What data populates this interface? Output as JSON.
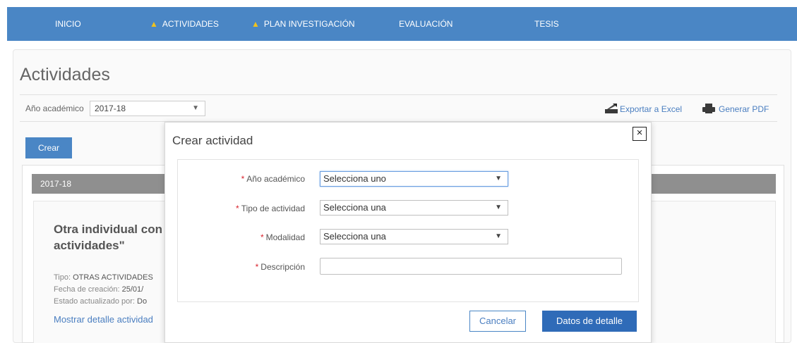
{
  "nav": {
    "items": [
      {
        "label": "INICIO",
        "warning": false
      },
      {
        "label": "ACTIVIDADES",
        "warning": true
      },
      {
        "label": "PLAN INVESTIGACIÓN",
        "warning": true
      },
      {
        "label": "EVALUACIÓN",
        "warning": false
      },
      {
        "label": "TESIS",
        "warning": false
      }
    ]
  },
  "page": {
    "title": "Actividades",
    "year_label": "Año académico",
    "year_value": "2017-18",
    "export_excel": "Exportar a Excel",
    "export_pdf": "Generar PDF",
    "create_button": "Crear"
  },
  "section": {
    "header": "2017-18",
    "card": {
      "title": "Otra individual con \"",
      "title_line2": "actividades\"",
      "tipo_label": "Tipo:",
      "tipo_value": "OTRAS ACTIVIDADES",
      "fecha_label": "Fecha de creación:",
      "fecha_value": "25/01/",
      "estado_label": "Estado actualizado por:",
      "estado_value": "Do",
      "detail_link": "Mostrar detalle actividad"
    }
  },
  "modal": {
    "title": "Crear actividad",
    "close_label": "×",
    "fields": {
      "year": {
        "label": "Año académico",
        "value": "Selecciona uno"
      },
      "tipo": {
        "label": "Tipo de actividad",
        "value": "Selecciona una"
      },
      "modalidad": {
        "label": "Modalidad",
        "value": "Selecciona una"
      },
      "descripcion": {
        "label": "Descripción",
        "value": ""
      }
    },
    "required_mark": "*",
    "cancel_button": "Cancelar",
    "detail_button": "Datos de detalle"
  },
  "colors": {
    "nav_bg": "#4a86c5",
    "warning": "#f0c21c",
    "primary_button": "#2f6bb8",
    "link": "#4a7ec0",
    "required": "#d9232d",
    "section_header": "#8f8f8f"
  },
  "icons": {
    "warning": "warning-triangle-icon",
    "excel": "excel-export-icon",
    "pdf": "printer-icon",
    "dropdown": "chevron-down-icon",
    "close": "close-icon"
  }
}
